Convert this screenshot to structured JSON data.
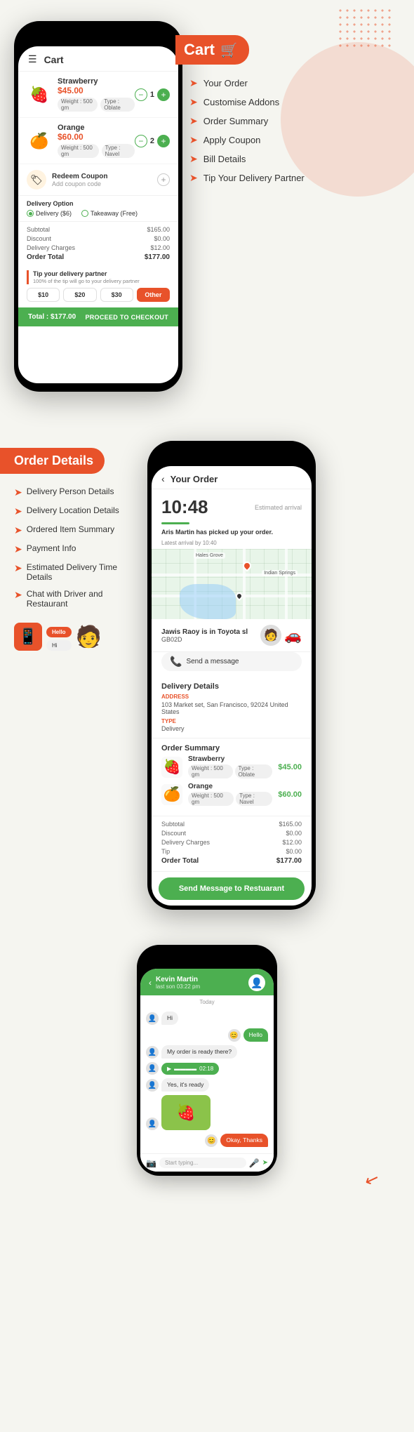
{
  "cart": {
    "title": "Cart",
    "items": [
      {
        "name": "Strawberry",
        "price": "$45.00",
        "emoji": "🍓",
        "qty": "1",
        "tags": [
          "Weight : 500 gm",
          "Type : Oblate"
        ]
      },
      {
        "name": "Orange",
        "price": "$60.00",
        "emoji": "🍊",
        "qty": "2",
        "tags": [
          "Weight : 500 gm",
          "Type : Navel"
        ]
      }
    ],
    "redeem_title": "Redeem Coupon",
    "redeem_sub": "Add coupon code",
    "delivery_option_label": "Delivery Option",
    "delivery_option": "Delivery ($6)",
    "takeaway_option": "Takeaway (Free)",
    "subtotal_label": "Subtotal",
    "subtotal_value": "$165.00",
    "discount_label": "Discount",
    "discount_value": "$0.00",
    "charges_label": "Delivery Charges",
    "charges_value": "$12.00",
    "total_label": "Order Total",
    "total_value": "$177.00",
    "tip_title": "Tip your delivery partner",
    "tip_sub": "100% of the tip will go to your delivery partner",
    "tip_options": [
      "$10",
      "$20",
      "$30",
      "Other"
    ],
    "checkout_total": "Total : $177.00",
    "checkout_btn": "PROCEED TO CHECKOUT"
  },
  "cart_panel": {
    "banner": "Cart",
    "features": [
      "Your Order",
      "Customise Addons",
      "Order Summary",
      "Apply Coupon",
      "Bill Details",
      "Tip Your Delivery Partner"
    ]
  },
  "order_details": {
    "banner": "Order Details",
    "features": [
      "Delivery Person Details",
      "Delivery Location Details",
      "Ordered Item Summary",
      "Payment Info",
      "Estimated Delivery Time Details",
      "Chat with Driver and Restaurant"
    ]
  },
  "order_phone": {
    "header": "Your Order",
    "time": "10:48",
    "arrival_label": "Estimated arrival",
    "picked_msg_pre": "Aris Martin",
    "picked_msg_post": " has picked up your order.",
    "latest": "Latest arrival by 10:40",
    "driver_name": "Jawis Raoy is in Toyota sl",
    "driver_car": "GB02D",
    "send_message": "Send a message",
    "delivery_details_title": "Delivery Details",
    "address_label": "ADDRESS",
    "address": "103 Market set, San Francisco, 92024 United States",
    "type_label": "TYPE",
    "type_value": "Delivery",
    "order_summary_title": "Order Summary",
    "items": [
      {
        "name": "Strawberry",
        "price": "$45.00",
        "emoji": "🍓",
        "tags": [
          "Weight : 500 gm",
          "Type : Oblate"
        ]
      },
      {
        "name": "Orange",
        "price": "$60.00",
        "emoji": "🍊",
        "tags": [
          "Weight : 500 gm",
          "Type : Navel"
        ]
      }
    ],
    "subtotal_label": "Subtotal",
    "subtotal": "$165.00",
    "discount_label": "Discount",
    "discount": "$0.00",
    "charges_label": "Delivery Charges",
    "charges": "$12.00",
    "tip_label": "Tip",
    "tip": "$0.00",
    "total_label": "Order Total",
    "total": "$177.00",
    "send_restaurant_btn": "Send Message to Restuarant"
  },
  "chat": {
    "contact": "Kevin Martin",
    "last_seen": "last son 03:22 pm",
    "date_divider": "Today",
    "messages": [
      {
        "side": "left",
        "text": "Hi"
      },
      {
        "side": "right",
        "text": "Hello"
      },
      {
        "side": "left",
        "text": "My order is ready there?"
      },
      {
        "side": "left",
        "type": "voice",
        "duration": "02:18"
      },
      {
        "side": "left",
        "text": "Yes, it's ready"
      },
      {
        "side": "left",
        "type": "image"
      },
      {
        "side": "right",
        "text": "Okay, Thanks"
      }
    ],
    "input_placeholder": "Start typing..."
  },
  "sections": {
    "apply_coupon": "Apply Coupon",
    "tip_delivery": "Tip Your Delivery Partner",
    "delivery_person": "Delivery Person Details",
    "delivery_location": "Delivery Location Details",
    "ordered_summary": "Ordered Item Summary",
    "payment_info": "Payment Info",
    "estimated_delivery": "Estimated Delivery Time Details",
    "chat_driver": "Chat with Driver and Restaurant"
  }
}
